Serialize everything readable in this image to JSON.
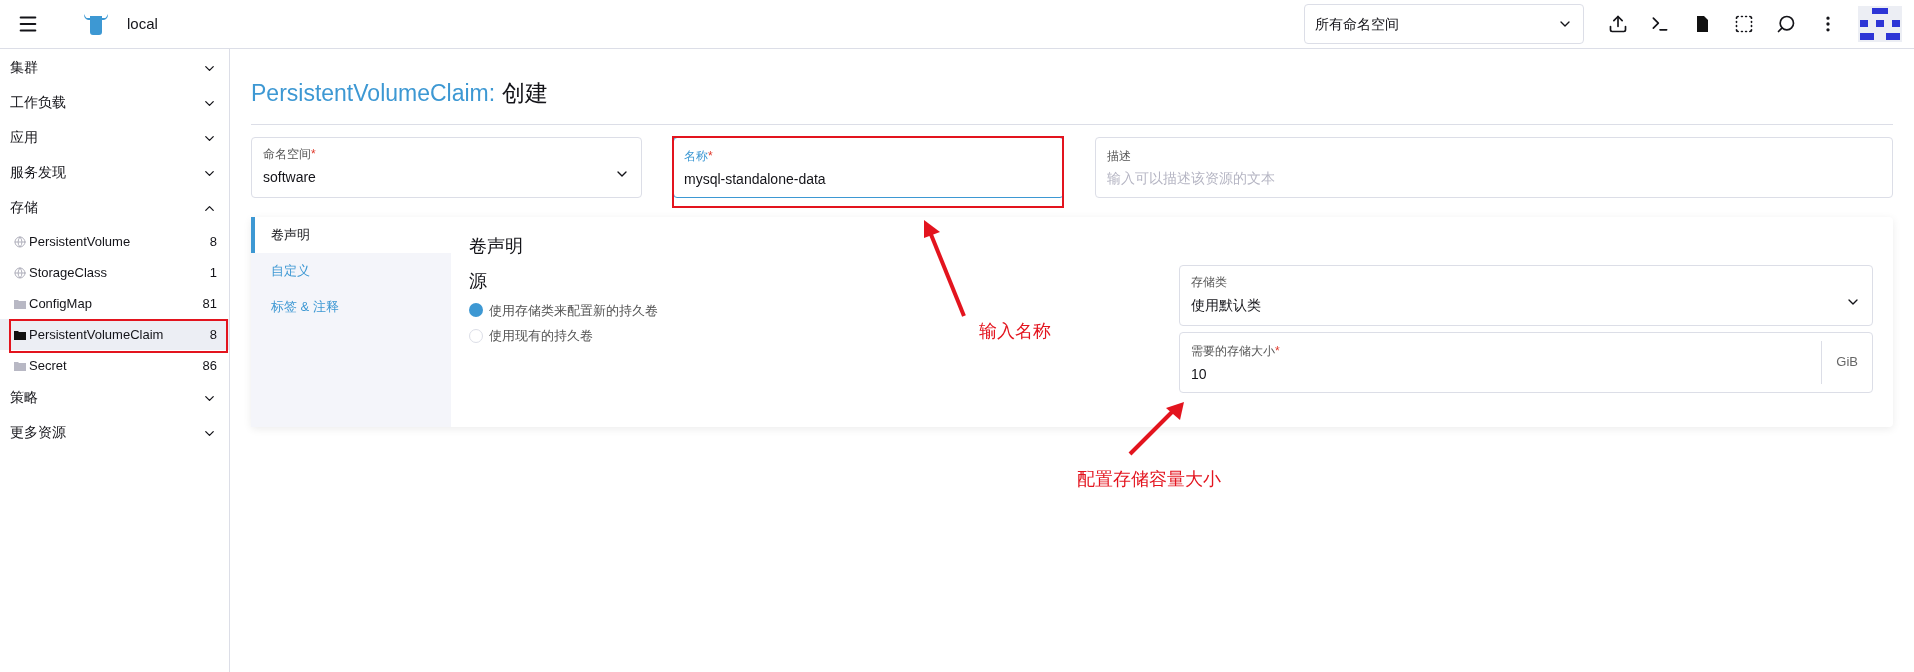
{
  "header": {
    "cluster": "local",
    "namespace_select": "所有命名空间"
  },
  "sidebar": [
    {
      "label": "集群",
      "expanded": false
    },
    {
      "label": "工作负载",
      "expanded": false
    },
    {
      "label": "应用",
      "expanded": false
    },
    {
      "label": "服务发现",
      "expanded": false
    },
    {
      "label": "存储",
      "expanded": true,
      "children": [
        {
          "label": "PersistentVolume",
          "count": "8",
          "kind": "globe",
          "selected": false
        },
        {
          "label": "StorageClass",
          "count": "1",
          "kind": "globe",
          "selected": false
        },
        {
          "label": "ConfigMap",
          "count": "81",
          "kind": "folder",
          "selected": false
        },
        {
          "label": "PersistentVolumeClaim",
          "count": "8",
          "kind": "folder",
          "selected": true
        },
        {
          "label": "Secret",
          "count": "86",
          "kind": "folder",
          "selected": false
        }
      ]
    },
    {
      "label": "策略",
      "expanded": false
    },
    {
      "label": "更多资源",
      "expanded": false
    }
  ],
  "page_title": {
    "resource": "PersistentVolumeClaim:",
    "action": "创建"
  },
  "namespace_field": {
    "label": "命名空间",
    "required_mark": "*",
    "value": "software"
  },
  "name_field": {
    "label": "名称",
    "required_mark": "*",
    "value": "mysql-standalone-data",
    "focused": true
  },
  "description_field": {
    "label": "描述",
    "placeholder": "输入可以描述该资源的文本"
  },
  "tabs": [
    {
      "label": "卷声明",
      "selected": true
    },
    {
      "label": "自定义",
      "selected": false
    },
    {
      "label": "标签 & 注释",
      "selected": false
    }
  ],
  "section": {
    "title": "卷声明",
    "source_heading": "源",
    "radios": [
      {
        "label": "使用存储类来配置新的持久卷",
        "selected": true
      },
      {
        "label": "使用现有的持久卷",
        "selected": false
      }
    ],
    "storage_class": {
      "label": "存储类",
      "value": "使用默认类"
    },
    "storage_size": {
      "label": "需要的存储大小",
      "required_mark": "*",
      "value": "10",
      "unit": "GiB"
    }
  },
  "annotations": [
    {
      "text": "输入名称"
    },
    {
      "text": "配置存储容量大小"
    }
  ]
}
